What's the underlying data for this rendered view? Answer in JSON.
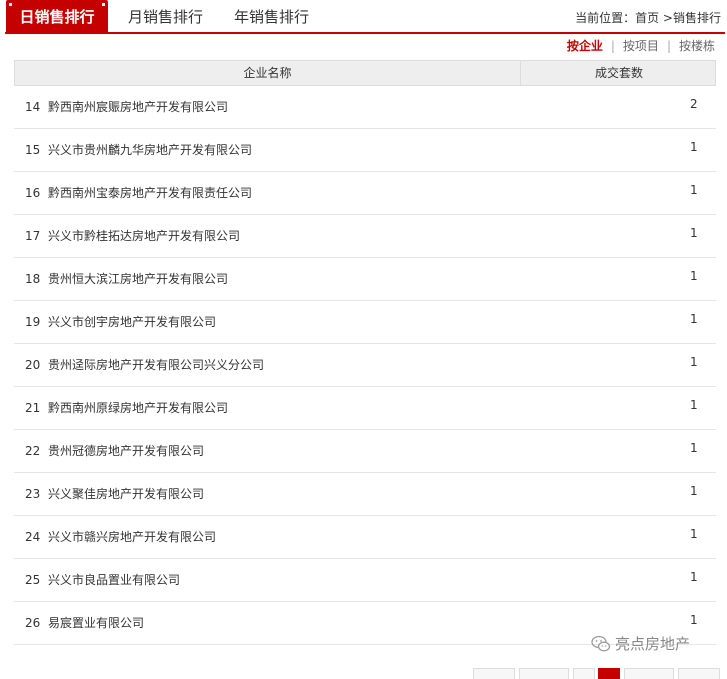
{
  "tabs": [
    {
      "label": "日销售排行"
    },
    {
      "label": "月销售排行"
    },
    {
      "label": "年销售排行"
    }
  ],
  "breadcrumb": {
    "prefix": "当前位置：",
    "home": "首页",
    "separator": " >",
    "current": "销售排行"
  },
  "sort_options": [
    {
      "label": "按企业"
    },
    {
      "label": "按项目"
    },
    {
      "label": "按楼栋"
    }
  ],
  "sort_separator": "|",
  "table": {
    "columns": [
      "企业名称",
      "成交套数"
    ],
    "rows": [
      {
        "rank": "14",
        "company": "黔西南州宸赈房地产开发有限公司",
        "count": "2"
      },
      {
        "rank": "15",
        "company": "兴义市贵州麟九华房地产开发有限公司",
        "count": "1"
      },
      {
        "rank": "16",
        "company": "黔西南州宝泰房地产开发有限责任公司",
        "count": "1"
      },
      {
        "rank": "17",
        "company": "兴义市黔桂拓达房地产开发有限公司",
        "count": "1"
      },
      {
        "rank": "18",
        "company": "贵州恒大滨江房地产开发有限公司",
        "count": "1"
      },
      {
        "rank": "19",
        "company": "兴义市创宇房地产开发有限公司",
        "count": "1"
      },
      {
        "rank": "20",
        "company": "贵州迳际房地产开发有限公司兴义分公司",
        "count": "1"
      },
      {
        "rank": "21",
        "company": "黔西南州原绿房地产开发有限公司",
        "count": "1"
      },
      {
        "rank": "22",
        "company": "贵州冠德房地产开发有限公司",
        "count": "1"
      },
      {
        "rank": "23",
        "company": "兴义聚佳房地产开发有限公司",
        "count": "1"
      },
      {
        "rank": "24",
        "company": "兴义市赣兴房地产开发有限公司",
        "count": "1"
      },
      {
        "rank": "25",
        "company": "兴义市良品置业有限公司",
        "count": "1"
      },
      {
        "rank": "26",
        "company": "易宸置业有限公司",
        "count": "1"
      }
    ]
  },
  "watermark": {
    "text": "亮点房地产",
    "icon": "wechat-icon"
  },
  "colors": {
    "accent": "#c40000",
    "header_bg": "#eeeeee"
  }
}
